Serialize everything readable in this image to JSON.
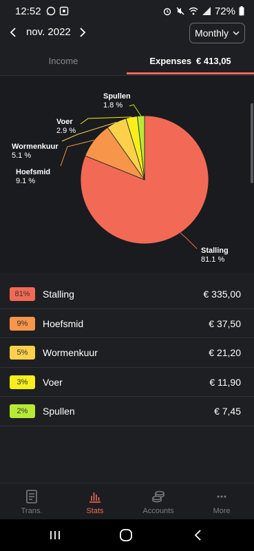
{
  "status_bar": {
    "time": "12:52",
    "battery": "72%",
    "icons_left": [
      "whatsapp-icon",
      "app-notification-icon"
    ],
    "icons_right": [
      "alarm-icon",
      "mute-icon",
      "wifi-icon",
      "signal-icon",
      "battery-icon"
    ]
  },
  "header": {
    "prev_icon": "chevron-left-icon",
    "month": "nov. 2022",
    "next_icon": "chevron-right-icon",
    "period": "Monthly",
    "period_icon": "chevron-down-icon"
  },
  "tabs": {
    "income": "Income",
    "expenses": "Expenses",
    "expenses_total": "€ 413,05",
    "active": "expenses"
  },
  "colors": {
    "accent": "#f26a55",
    "stalling": "#f26a55",
    "hoefsmid": "#f7954a",
    "wormenkuur": "#fbd14b",
    "voer": "#f7ee1c",
    "spullen": "#b7ea35"
  },
  "chart_data": {
    "type": "pie",
    "title": "",
    "slices": [
      {
        "label": "Stalling",
        "percent": 81.1,
        "percent_label": "81.1 %",
        "color": "#f26a55"
      },
      {
        "label": "Hoefsmid",
        "percent": 9.1,
        "percent_label": "9.1 %",
        "color": "#f7954a"
      },
      {
        "label": "Wormenkuur",
        "percent": 5.1,
        "percent_label": "5.1 %",
        "color": "#fbd14b"
      },
      {
        "label": "Voer",
        "percent": 2.9,
        "percent_label": "2.9 %",
        "color": "#f7ee1c"
      },
      {
        "label": "Spullen",
        "percent": 1.8,
        "percent_label": "1.8 %",
        "color": "#b7ea35"
      }
    ]
  },
  "categories": [
    {
      "badge": "81%",
      "name": "Stalling",
      "amount": "€ 335,00",
      "color": "#f26a55"
    },
    {
      "badge": "9%",
      "name": "Hoefsmid",
      "amount": "€ 37,50",
      "color": "#f7954a"
    },
    {
      "badge": "5%",
      "name": "Wormenkuur",
      "amount": "€ 21,20",
      "color": "#fbd14b"
    },
    {
      "badge": "3%",
      "name": "Voer",
      "amount": "€ 11,90",
      "color": "#f7ee1c"
    },
    {
      "badge": "2%",
      "name": "Spullen",
      "amount": "€ 7,45",
      "color": "#b7ea35"
    }
  ],
  "bottom_nav": [
    {
      "label": "Trans.",
      "icon": "book-icon",
      "active": false
    },
    {
      "label": "Stats",
      "icon": "bar-chart-icon",
      "active": true
    },
    {
      "label": "Accounts",
      "icon": "coins-icon",
      "active": false
    },
    {
      "label": "More",
      "icon": "more-dots-icon",
      "active": false
    }
  ],
  "system_nav": [
    "recents-icon",
    "home-icon",
    "back-icon"
  ]
}
